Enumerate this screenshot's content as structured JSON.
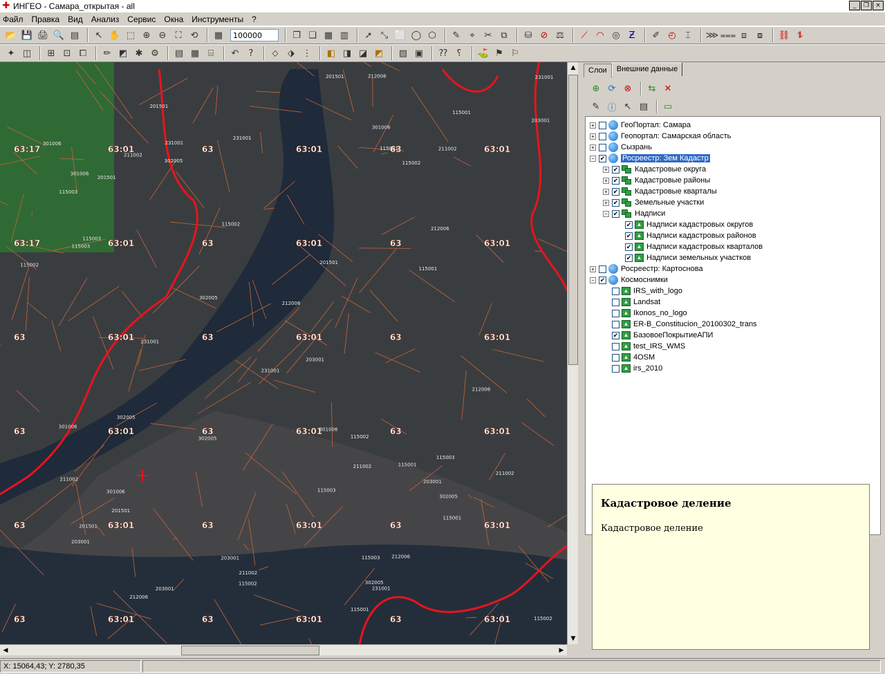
{
  "window": {
    "title": "ИНГЕО - Самара_открытая - all",
    "minimize": "_",
    "restore": "❐",
    "close": "×"
  },
  "menu": [
    "Файл",
    "Правка",
    "Вид",
    "Анализ",
    "Сервис",
    "Окна",
    "Инструменты",
    "?"
  ],
  "toolbar": {
    "scale_value": "100000"
  },
  "tabs": [
    "Слои",
    "Внешние данные"
  ],
  "tree": [
    {
      "label": "ГеоПортал: Самара",
      "level": 0,
      "expander": "+",
      "checked": false,
      "icon": "globe"
    },
    {
      "label": "Геопортал: Самарская область",
      "level": 0,
      "expander": "+",
      "checked": false,
      "icon": "globe"
    },
    {
      "label": "Сызрань",
      "level": 0,
      "expander": "+",
      "checked": false,
      "icon": "globe"
    },
    {
      "label": "Росреестр: Зем Кадастр",
      "level": 0,
      "expander": "−",
      "checked": true,
      "icon": "globe",
      "selected": true
    },
    {
      "label": "Кадастровые округа",
      "level": 1,
      "expander": "+",
      "checked": true,
      "icon": "multi"
    },
    {
      "label": "Кадастровые районы",
      "level": 1,
      "expander": "+",
      "checked": true,
      "icon": "multi"
    },
    {
      "label": "Кадастровые кварталы",
      "level": 1,
      "expander": "+",
      "checked": true,
      "icon": "multi"
    },
    {
      "label": "Земельные участки",
      "level": 1,
      "expander": "+",
      "checked": true,
      "icon": "multi"
    },
    {
      "label": "Надписи",
      "level": 1,
      "expander": "−",
      "checked": true,
      "icon": "multi"
    },
    {
      "label": "Надписи кадастровых округов",
      "level": 2,
      "expander": "",
      "checked": true,
      "icon": "layer"
    },
    {
      "label": "Надписи кадастровых районов",
      "level": 2,
      "expander": "",
      "checked": true,
      "icon": "layer"
    },
    {
      "label": "Надписи кадастровых кварталов",
      "level": 2,
      "expander": "",
      "checked": true,
      "icon": "layer"
    },
    {
      "label": "Надписи земельных участков",
      "level": 2,
      "expander": "",
      "checked": true,
      "icon": "layer"
    },
    {
      "label": "Росреестр: Картоснова",
      "level": 0,
      "expander": "+",
      "checked": false,
      "icon": "globe"
    },
    {
      "label": "Космоснимки",
      "level": 0,
      "expander": "−",
      "checked": true,
      "icon": "globe"
    },
    {
      "label": "IRS_with_logo",
      "level": 1,
      "expander": "",
      "checked": false,
      "icon": "layer"
    },
    {
      "label": "Landsat",
      "level": 1,
      "expander": "",
      "checked": false,
      "icon": "layer"
    },
    {
      "label": "Ikonos_no_logo",
      "level": 1,
      "expander": "",
      "checked": false,
      "icon": "layer"
    },
    {
      "label": "ER-B_Constitucion_20100302_trans",
      "level": 1,
      "expander": "",
      "checked": false,
      "icon": "layer"
    },
    {
      "label": "БазовоеПокрытиеАПИ",
      "level": 1,
      "expander": "",
      "checked": true,
      "icon": "layer"
    },
    {
      "label": "test_IRS_WMS",
      "level": 1,
      "expander": "",
      "checked": false,
      "icon": "layer"
    },
    {
      "label": "4OSM",
      "level": 1,
      "expander": "",
      "checked": false,
      "icon": "layer"
    },
    {
      "label": "irs_2010",
      "level": 1,
      "expander": "",
      "checked": false,
      "icon": "layer"
    }
  ],
  "description": {
    "heading": "Кадастровое деление",
    "body": "Кадастровое деление"
  },
  "status": {
    "coords": "X: 15064,43; Y: 2780,35"
  },
  "map": {
    "district_labels": [
      "63:17",
      "63:01",
      "63"
    ],
    "parcel_labels": [
      "231001",
      "301006",
      "115002",
      "201501",
      "212006",
      "302005",
      "115003",
      "211002",
      "203001",
      "115001"
    ]
  },
  "colors": {
    "boundary": "#e8141c",
    "parcel_line": "#c8663a",
    "water": "#1f2a3a",
    "land": "#3a3d40",
    "forest": "#2f6a34",
    "selected": "#316ac5",
    "description_bg": "#ffffe1"
  }
}
